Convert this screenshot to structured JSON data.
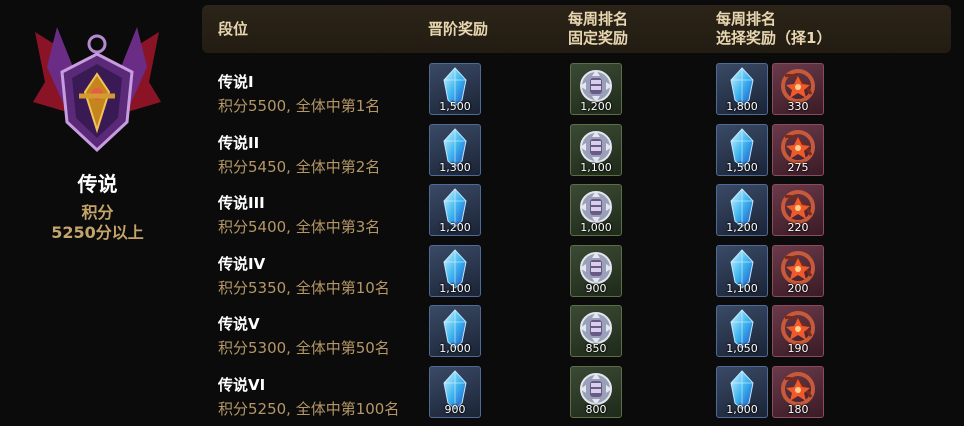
{
  "tier": {
    "name": "传说",
    "points_label": "积分",
    "points_req": "5250分以上"
  },
  "headers": {
    "rank": "段位",
    "promotion": "晋阶奖励",
    "weekly_fixed_l1": "每周排名",
    "weekly_fixed_l2": "固定奖励",
    "weekly_select_l1": "每周排名",
    "weekly_select_l2": "选择奖励（择1）"
  },
  "icons": {
    "tier_emblem": "legend-emblem-icon",
    "promotion": "blue-crystal-icon",
    "fixed": "silver-fist-medal-icon",
    "select_a": "blue-crystal-icon",
    "select_b": "flame-ring-token-icon"
  },
  "rows": [
    {
      "rank": "传说I",
      "desc": "积分5500, 全体中第1名",
      "promo": "1,500",
      "fixed": "1,200",
      "sel_a": "1,800",
      "sel_b": "330"
    },
    {
      "rank": "传说II",
      "desc": "积分5450, 全体中第2名",
      "promo": "1,300",
      "fixed": "1,100",
      "sel_a": "1,500",
      "sel_b": "275"
    },
    {
      "rank": "传说III",
      "desc": "积分5400, 全体中第3名",
      "promo": "1,200",
      "fixed": "1,000",
      "sel_a": "1,200",
      "sel_b": "220"
    },
    {
      "rank": "传说IV",
      "desc": "积分5350, 全体中第10名",
      "promo": "1,100",
      "fixed": "900",
      "sel_a": "1,100",
      "sel_b": "200"
    },
    {
      "rank": "传说V",
      "desc": "积分5300, 全体中第50名",
      "promo": "1,000",
      "fixed": "850",
      "sel_a": "1,050",
      "sel_b": "190"
    },
    {
      "rank": "传说VI",
      "desc": "积分5250, 全体中第100名",
      "promo": "900",
      "fixed": "800",
      "sel_a": "1,000",
      "sel_b": "180"
    }
  ]
}
